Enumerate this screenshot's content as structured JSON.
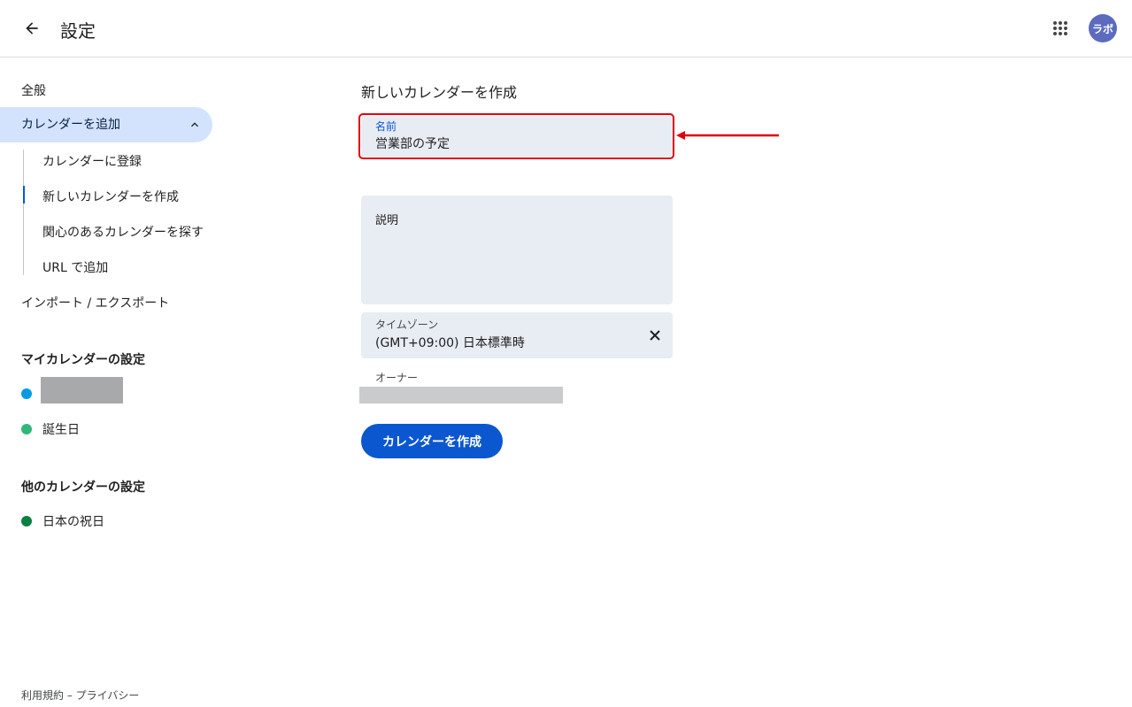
{
  "header": {
    "title": "設定",
    "avatar_text": "ラボ"
  },
  "sidebar": {
    "general": "全般",
    "add_calendar": "カレンダーを追加",
    "sub_items": [
      "カレンダーに登録",
      "新しいカレンダーを作成",
      "関心のあるカレンダーを探す",
      "URL で追加"
    ],
    "import_export": "インポート / エクスポート",
    "my_calendars_title": "マイカレンダーの設定",
    "my_calendars": [
      {
        "label": "",
        "color": "#039be5"
      },
      {
        "label": "誕生日",
        "color": "#33b679"
      }
    ],
    "other_calendars_title": "他のカレンダーの設定",
    "other_calendars": [
      {
        "label": "日本の祝日",
        "color": "#0b8043"
      }
    ],
    "footer": "利用規約 – プライバシー"
  },
  "form": {
    "title": "新しいカレンダーを作成",
    "name_label": "名前",
    "name_value": "営業部の予定",
    "description_label": "説明",
    "timezone_label": "タイムゾーン",
    "timezone_value": "(GMT+09:00) 日本標準時",
    "owner_label": "オーナー",
    "create_button": "カレンダーを作成"
  },
  "colors": {
    "accent": "#0b57d0",
    "highlight": "#e0000e",
    "nav_active_bg": "#d3e3fd",
    "field_bg": "#e8ecf3"
  }
}
